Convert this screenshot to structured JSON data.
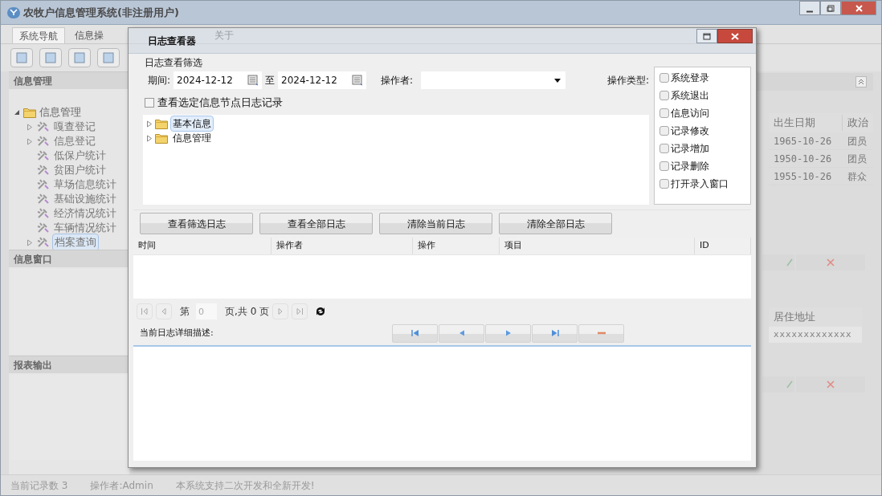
{
  "app": {
    "title": "农牧户信息管理系统(非注册用户)"
  },
  "menu_tabs": [
    {
      "label": "系统导航",
      "selected": true
    },
    {
      "label": "信息操",
      "selected": false
    },
    {
      "label": "关于",
      "selected": false
    }
  ],
  "sidebar": {
    "sections": [
      {
        "title": "信息管理",
        "tree": [
          {
            "label": "信息管理",
            "expanded": true,
            "children": [
              {
                "label": "嘎查登记",
                "expandable": true,
                "selected": false
              },
              {
                "label": "信息登记",
                "expandable": true,
                "selected": false
              },
              {
                "label": "低保户统计",
                "expandable": false,
                "selected": false
              },
              {
                "label": "贫困户统计",
                "expandable": false,
                "selected": false
              },
              {
                "label": "草场信息统计",
                "expandable": false,
                "selected": false
              },
              {
                "label": "基础设施统计",
                "expandable": false,
                "selected": false
              },
              {
                "label": "经济情况统计",
                "expandable": false,
                "selected": false
              },
              {
                "label": "车辆情况统计",
                "expandable": false,
                "selected": false
              },
              {
                "label": "档案查询",
                "expandable": true,
                "selected": true
              }
            ]
          }
        ]
      },
      {
        "title": "信息窗口"
      },
      {
        "title": "报表输出"
      }
    ]
  },
  "main_table": {
    "columns": [
      "出生日期",
      "政治"
    ],
    "rows": [
      [
        "1965-10-26",
        "团员"
      ],
      [
        "1950-10-26",
        "团员"
      ],
      [
        "1955-10-26",
        "群众"
      ]
    ]
  },
  "lower_table": {
    "columns": [
      "居住地址"
    ],
    "rows": [
      [
        "xxxxxxxxxxxxx"
      ]
    ]
  },
  "status_bar": [
    "当前记录数 3",
    "操作者:Admin",
    "本系统支持二次开发和全新开发!"
  ],
  "dialog": {
    "title": "日志查看器",
    "filter": {
      "group_label": "日志查看筛选",
      "period_label": "期间:",
      "date_from": "2024-12-12",
      "to_label": "至",
      "date_to": "2024-12-12",
      "operator_label": "操作者:",
      "type_label": "操作类型:",
      "types": [
        {
          "label": "系统登录",
          "checked": false
        },
        {
          "label": "系统退出",
          "checked": false
        },
        {
          "label": "信息访问",
          "checked": false
        },
        {
          "label": "记录修改",
          "checked": false
        },
        {
          "label": "记录增加",
          "checked": false
        },
        {
          "label": "记录删除",
          "checked": false
        },
        {
          "label": "打开录入窗口",
          "checked": false
        }
      ],
      "node_filter": {
        "label": "查看选定信息节点日志记录",
        "checked": false
      },
      "tree": [
        {
          "label": "基本信息",
          "selected": true
        },
        {
          "label": "信息管理",
          "selected": false
        }
      ]
    },
    "buttons": [
      "查看筛选日志",
      "查看全部日志",
      "清除当前日志",
      "清除全部日志"
    ],
    "log_table": {
      "columns": [
        "时间",
        "操作者",
        "操作",
        "项目",
        "ID"
      ]
    },
    "pager": {
      "page_prefix": "第",
      "page_value": "0",
      "page_suffix": "页,共 0 页"
    },
    "detail": {
      "label": "当前日志详细描述:",
      "nav": [
        {
          "kind": "first"
        },
        {
          "kind": "prev"
        },
        {
          "kind": "next"
        },
        {
          "kind": "last"
        },
        {
          "kind": "remove"
        }
      ]
    }
  }
}
